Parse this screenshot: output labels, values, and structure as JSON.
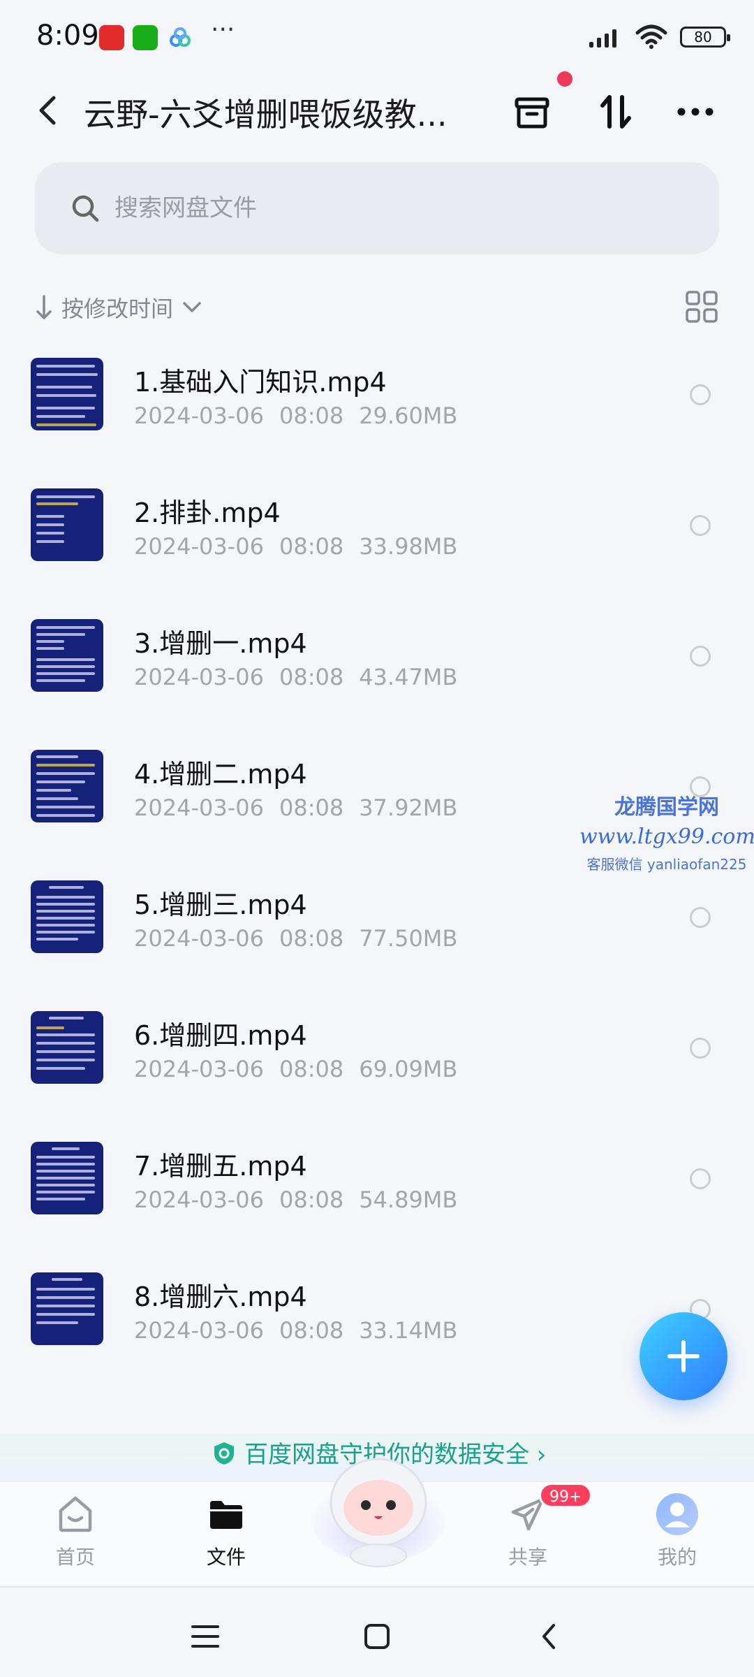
{
  "status_bar": {
    "time": "8:09",
    "dots": "···",
    "battery": "80",
    "app_icons": [
      "news-app-icon",
      "wechat-icon",
      "baidu-netdisk-icon"
    ]
  },
  "header": {
    "title": "云野-六爻增删喂饭级教...",
    "icons": [
      "back-icon",
      "archive-box-icon",
      "sort-arrows-icon",
      "more-icon"
    ],
    "notification_dot_color": "#f0385a"
  },
  "search": {
    "placeholder": "搜索网盘文件"
  },
  "sort": {
    "label": "按修改时间",
    "view_toggle_icon": "grid-view-icon"
  },
  "files": [
    {
      "name": "1.基础入门知识.mp4",
      "date": "2024-03-06",
      "time": "08:08",
      "size": "29.60MB"
    },
    {
      "name": "2.排卦.mp4",
      "date": "2024-03-06",
      "time": "08:08",
      "size": "33.98MB"
    },
    {
      "name": "3.增删一.mp4",
      "date": "2024-03-06",
      "time": "08:08",
      "size": "43.47MB"
    },
    {
      "name": "4.增删二.mp4",
      "date": "2024-03-06",
      "time": "08:08",
      "size": "37.92MB"
    },
    {
      "name": "5.增删三.mp4",
      "date": "2024-03-06",
      "time": "08:08",
      "size": "77.50MB"
    },
    {
      "name": "6.增删四.mp4",
      "date": "2024-03-06",
      "time": "08:08",
      "size": "69.09MB"
    },
    {
      "name": "7.增删五.mp4",
      "date": "2024-03-06",
      "time": "08:08",
      "size": "54.89MB"
    },
    {
      "name": "8.增删六.mp4",
      "date": "2024-03-06",
      "time": "08:08",
      "size": "33.14MB"
    }
  ],
  "watermark": {
    "line1": "龙腾国学网",
    "line2": "www.ltgx99.com",
    "line3": "客服微信 yanliaofan225"
  },
  "promo": {
    "text": "百度网盘守护你的数据安全 ›"
  },
  "bottom_nav": {
    "items": [
      {
        "label": "首页",
        "icon": "home-icon"
      },
      {
        "label": "文件",
        "icon": "folder-icon"
      },
      {
        "label": "共享",
        "icon": "share-plane-icon"
      },
      {
        "label": "我的",
        "icon": "profile-avatar-icon"
      }
    ],
    "share_badge": "99+",
    "accent": "#2e7dff"
  }
}
